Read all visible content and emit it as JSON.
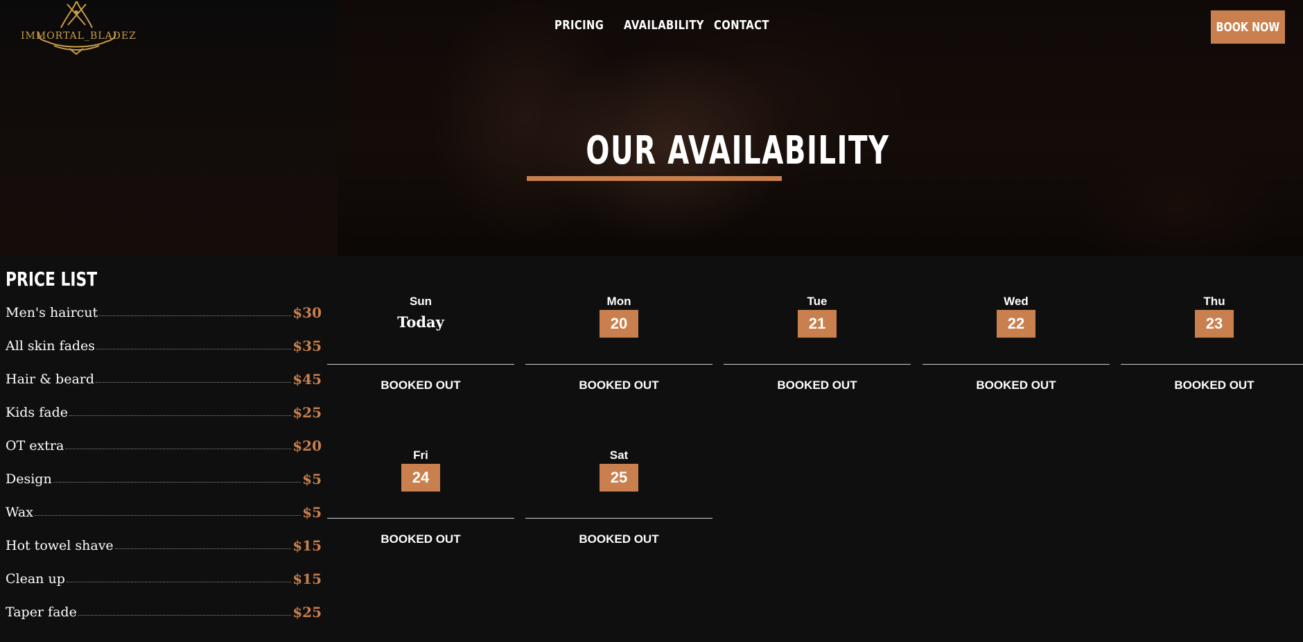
{
  "header": {
    "logo_text": "IMMORTAL_BLADEZ",
    "nav": [
      "PRICING",
      "AVAILABILITY",
      "CONTACT"
    ],
    "book_label": "BOOK NOW"
  },
  "hero": {
    "title": "OUR AVAILABILITY"
  },
  "price_list": {
    "title": "PRICE LIST",
    "items": [
      {
        "name": "Men's haircut",
        "price": "$30"
      },
      {
        "name": "All skin fades",
        "price": "$35"
      },
      {
        "name": "Hair & beard",
        "price": "$45"
      },
      {
        "name": "Kids fade",
        "price": "$25"
      },
      {
        "name": "OT extra",
        "price": "$20"
      },
      {
        "name": "Design",
        "price": "$5"
      },
      {
        "name": "Wax",
        "price": "$5"
      },
      {
        "name": "Hot towel shave",
        "price": "$15"
      },
      {
        "name": "Clean up",
        "price": "$15"
      },
      {
        "name": "Taper fade",
        "price": "$25"
      }
    ]
  },
  "calendar": {
    "days": [
      {
        "name": "Sun",
        "date": "Today",
        "status": "BOOKED OUT"
      },
      {
        "name": "Mon",
        "date": "20",
        "status": "BOOKED OUT"
      },
      {
        "name": "Tue",
        "date": "21",
        "status": "BOOKED OUT"
      },
      {
        "name": "Wed",
        "date": "22",
        "status": "BOOKED OUT"
      },
      {
        "name": "Thu",
        "date": "23",
        "status": "BOOKED OUT"
      },
      {
        "name": "Fri",
        "date": "24",
        "status": "BOOKED OUT"
      },
      {
        "name": "Sat",
        "date": "25",
        "status": "BOOKED OUT"
      }
    ]
  },
  "colors": {
    "accent": "#c9804e",
    "background": "#0f0f0f",
    "logo_gold": "#c9a04a"
  }
}
